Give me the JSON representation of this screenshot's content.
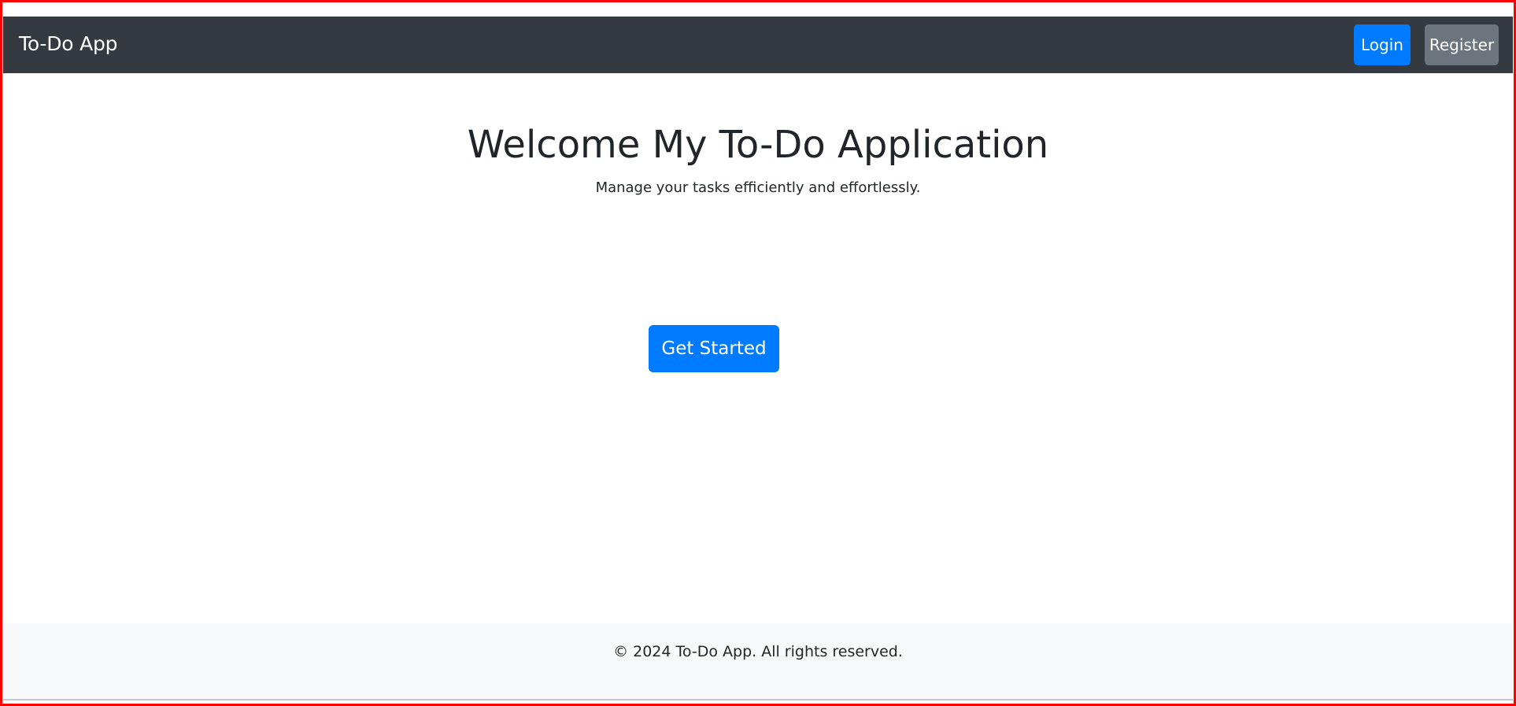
{
  "navbar": {
    "brand": "To-Do App",
    "login_label": "Login",
    "register_label": "Register"
  },
  "hero": {
    "title": "Welcome My To-Do Application",
    "subtitle": "Manage your tasks efficiently and effortlessly.",
    "cta_label": "Get Started"
  },
  "footer": {
    "text": "© 2024 To-Do App. All rights reserved."
  },
  "colors": {
    "navbar_background": "#343a40",
    "primary": "#007bff",
    "secondary": "#6c757d",
    "footer_background": "#f8f9fa",
    "frame_border": "#ff0000"
  }
}
